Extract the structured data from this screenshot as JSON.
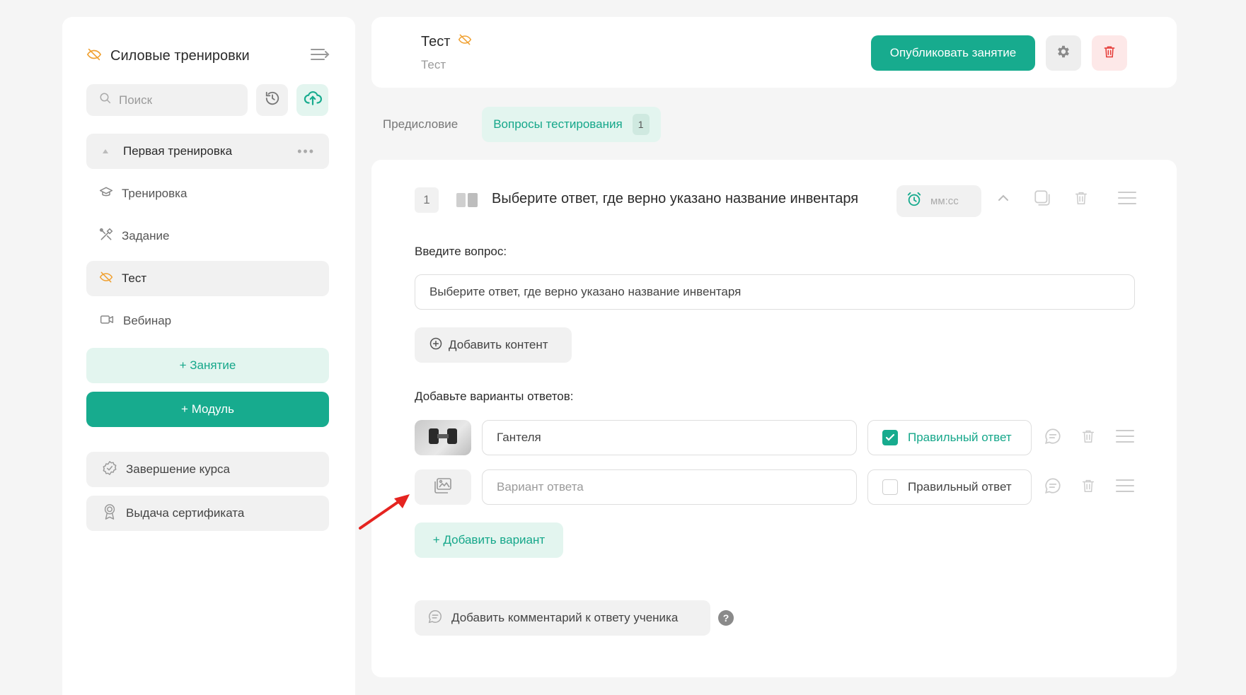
{
  "sidebar": {
    "course_title": "Силовые тренировки",
    "search_placeholder": "Поиск",
    "module": {
      "label": "Первая тренировка"
    },
    "lessons": [
      {
        "label": "Тренировка",
        "icon": "graduation-cap-icon"
      },
      {
        "label": "Задание",
        "icon": "tools-icon"
      },
      {
        "label": "Тест",
        "icon": "hidden-eye-icon",
        "active": true
      },
      {
        "label": "Вебинар",
        "icon": "video-camera-icon"
      }
    ],
    "add_lesson_label": "+ Занятие",
    "add_module_label": "+ Модуль",
    "course_completion_label": "Завершение курса",
    "certificate_label": "Выдача сертификата"
  },
  "header": {
    "title": "Тест",
    "subtitle": "Тест",
    "publish_label": "Опубликовать занятие"
  },
  "tabs": [
    {
      "label": "Предисловие"
    },
    {
      "label": "Вопросы тестирования",
      "badge": "1",
      "active": true
    }
  ],
  "question": {
    "number": "1",
    "title": "Выберите ответ, где верно указано название инвентаря",
    "timer_placeholder": "мм:сс",
    "prompt_label": "Введите вопрос:",
    "prompt_value": "Выберите ответ, где верно указано название инвентаря",
    "add_content_label": "Добавить контент",
    "answers_label": "Добавьте варианты ответов:",
    "answers": [
      {
        "value": "Гантеля",
        "placeholder": "Вариант ответа",
        "correct_label": "Правильный ответ",
        "correct": true,
        "has_image": true
      },
      {
        "value": "",
        "placeholder": "Вариант ответа",
        "correct_label": "Правильный ответ",
        "correct": false,
        "has_image": false
      }
    ],
    "add_variant_label": "+ Добавить вариант",
    "add_comment_label": "Добавить комментарий к ответу ученика",
    "help_glyph": "?"
  },
  "colors": {
    "accent": "#17ab8e",
    "accent_light": "#e3f5ef",
    "hidden_icon": "#f0a030",
    "danger": "#e53935",
    "annotation_arrow": "#e52420"
  }
}
